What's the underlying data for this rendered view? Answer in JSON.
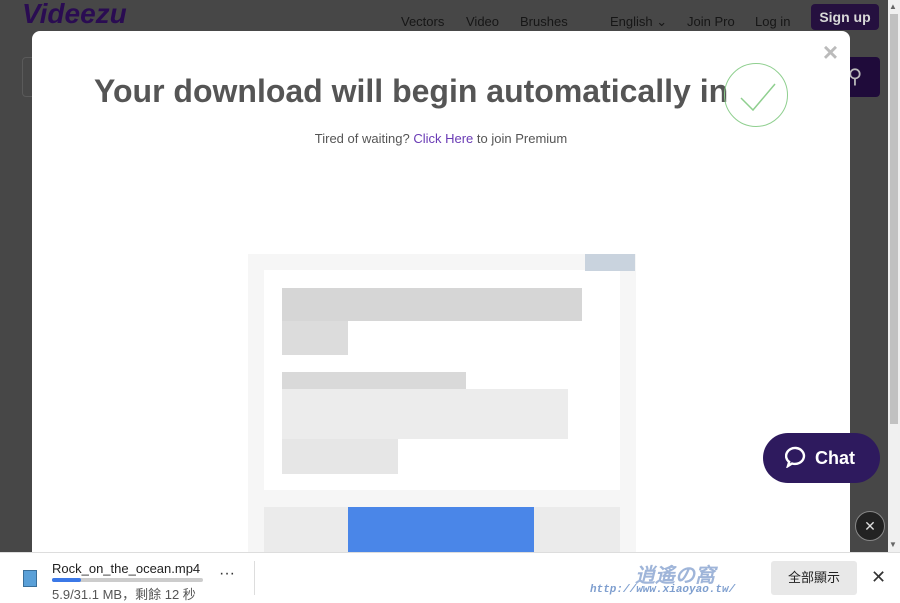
{
  "site": {
    "logo": "Videezu",
    "nav": [
      "Vectors",
      "Video",
      "Brushes",
      "English ⌄",
      "Join Pro",
      "Log in"
    ],
    "signup": "Sign up"
  },
  "modal": {
    "close": "×",
    "title": "Your download will begin automatically in",
    "sub_prefix": "Tired of waiting?",
    "sub_link": "Click Here",
    "sub_suffix": "to join Premium"
  },
  "chat": {
    "label": "Chat"
  },
  "download": {
    "filename": "Rock_on_the_ocean.mp4",
    "progress_percent": 19,
    "status": "5.9/31.1 MB，剩餘 12 秒",
    "more": "···",
    "show_all": "全部顯示",
    "close": "✕"
  },
  "watermark": {
    "text": "逍遙の窩",
    "url": "http://www.xiaoyao.tw/"
  },
  "colors": {
    "brand": "#4a1a8a",
    "chat": "#2e1a5e",
    "link": "#6a3bb5",
    "progress": "#3b78e7"
  }
}
